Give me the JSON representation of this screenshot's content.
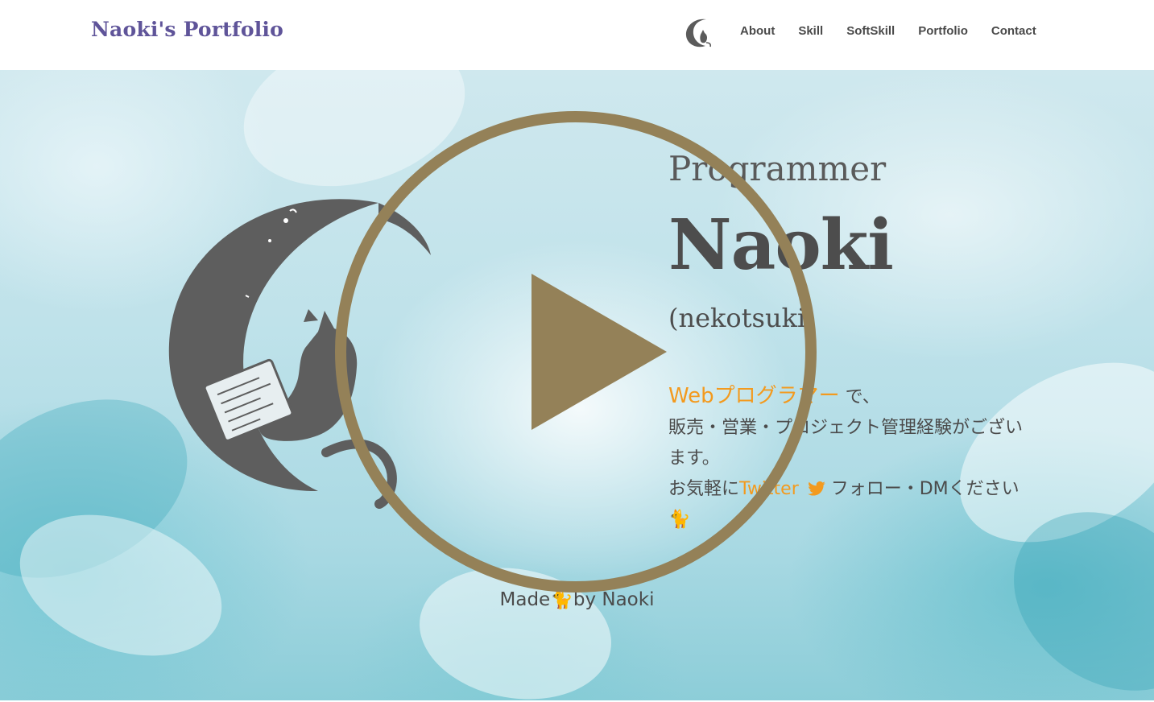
{
  "header": {
    "brand": "Naoki's Portfolio",
    "logo_icon": "cat-moon-logo-icon",
    "nav": [
      "About",
      "Skill",
      "SoftSkill",
      "Portfolio",
      "Contact"
    ]
  },
  "hero": {
    "role": "Programmer",
    "name": "Naoki",
    "handle": "(nekotsuki)",
    "desc_link": "Webプログラマー",
    "desc_after_link": " で、",
    "desc_line2": "販売・営業・プロジェクト管理経験がございます。",
    "desc_line3_pre": "お気軽に",
    "twitter_label": "Twitter",
    "twitter_icon": "twitter-bird-icon",
    "desc_line3_post": " フォロー・DMください",
    "cat_emoji": "🐈",
    "illustration": "cat-on-crescent-moon-with-laptop"
  },
  "footer": {
    "made": "Made ",
    "cat_emoji": "🐈",
    "by": " by Naoki"
  },
  "overlay": {
    "icon": "play-icon",
    "color": "#948158"
  },
  "colors": {
    "brand": "#5f5499",
    "accent": "#f39a1e",
    "text": "#4d4d4d"
  }
}
